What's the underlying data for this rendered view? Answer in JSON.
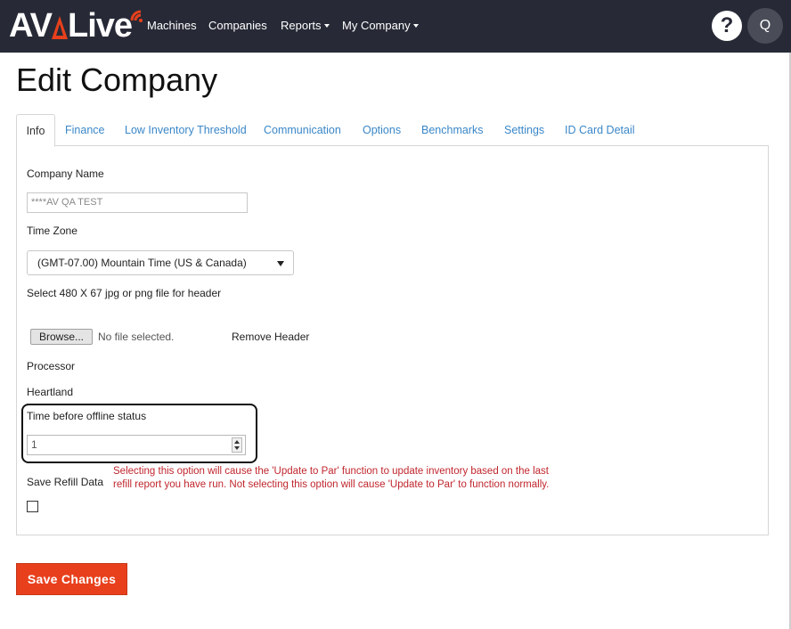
{
  "brand": {
    "logo_text_left": "AV",
    "logo_text_right": "Live",
    "colors": {
      "topbar": "#272a36",
      "accent": "#e8401c",
      "link": "#3a87c8",
      "warning": "#c0262d"
    }
  },
  "nav": {
    "items": [
      {
        "label": "Machines",
        "has_caret": false
      },
      {
        "label": "Companies",
        "has_caret": false
      },
      {
        "label": "Reports",
        "has_caret": true
      },
      {
        "label": "My Company",
        "has_caret": true
      }
    ],
    "help_icon": "question-mark-icon",
    "help_label": "?",
    "avatar_initial": "Q"
  },
  "page": {
    "title": "Edit Company"
  },
  "tabs": [
    {
      "label": "Info",
      "active": true
    },
    {
      "label": "Finance",
      "active": false
    },
    {
      "label": "Low Inventory Threshold",
      "active": false
    },
    {
      "label": "Communication",
      "active": false
    },
    {
      "label": "Options",
      "active": false
    },
    {
      "label": "Benchmarks",
      "active": false
    },
    {
      "label": "Settings",
      "active": false
    },
    {
      "label": "ID Card Detail",
      "active": false
    }
  ],
  "form": {
    "company_name_label": "Company Name",
    "company_name_value": "****AV QA TEST",
    "time_zone_label": "Time Zone",
    "time_zone_value": "(GMT-07.00) Mountain Time (US & Canada)",
    "header_file_label": "Select 480 X 67 jpg or png file for header",
    "browse_label": "Browse...",
    "no_file_text": "No file selected.",
    "remove_header_label": "Remove Header",
    "processor_label": "Processor",
    "processor_value": "Heartland",
    "offline_label": "Time before offline status",
    "offline_value": "1",
    "save_refill_label": "Save Refill Data",
    "save_refill_checked": false,
    "save_refill_warning": "Selecting this option will cause the 'Update to Par' function to update inventory based on the last refill report you have run. Not selecting this option will cause 'Update to Par' to function normally."
  },
  "actions": {
    "save_label": "Save Changes"
  }
}
